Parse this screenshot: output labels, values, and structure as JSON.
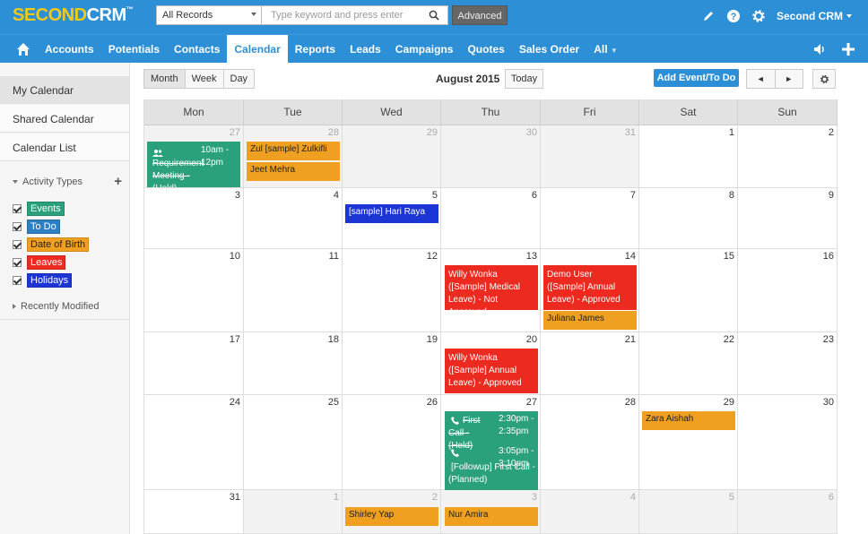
{
  "app": {
    "logo_part1": "SECOND",
    "logo_part2": "CRM",
    "logo_tm": "™",
    "brand_yellow": "#f5c81c",
    "brand_blue": "#2d8fd6"
  },
  "search": {
    "record_type": "All Records",
    "placeholder": "Type keyword and press enter",
    "advanced_label": "Advanced"
  },
  "user": {
    "name": "Second CRM"
  },
  "top_icons": [
    "pencil-icon",
    "help-icon",
    "gear-icon"
  ],
  "nav": {
    "items": [
      "Accounts",
      "Potentials",
      "Contacts",
      "Calendar",
      "Reports",
      "Leads",
      "Campaigns",
      "Quotes",
      "Sales Order",
      "All"
    ],
    "active": "Calendar"
  },
  "sidebar": {
    "items": [
      "My Calendar",
      "Shared Calendar",
      "Calendar List"
    ],
    "activity_types_label": "Activity Types",
    "activity_types": [
      {
        "label": "Events",
        "color": "#2aa07c"
      },
      {
        "label": "To Do",
        "color": "#2d7fc1"
      },
      {
        "label": "Date of Birth",
        "color": "#f0a020"
      },
      {
        "label": "Leaves",
        "color": "#ec2a1f"
      },
      {
        "label": "Holidays",
        "color": "#1c35d5"
      }
    ],
    "recently_modified_label": "Recently Modified"
  },
  "calendar": {
    "views": [
      "Month",
      "Week",
      "Day"
    ],
    "active_view": "Month",
    "title": "August 2015",
    "today_label": "Today",
    "add_label": "Add Event/To Do",
    "prev_label": "◄",
    "next_label": "►",
    "days_of_week": [
      "Mon",
      "Tue",
      "Wed",
      "Thu",
      "Fri",
      "Sat",
      "Sun"
    ],
    "weeks": [
      [
        "27",
        "28",
        "29",
        "30",
        "31",
        "1",
        "2"
      ],
      [
        "3",
        "4",
        "5",
        "6",
        "7",
        "8",
        "9"
      ],
      [
        "10",
        "11",
        "12",
        "13",
        "14",
        "15",
        "16"
      ],
      [
        "17",
        "18",
        "19",
        "20",
        "21",
        "22",
        "23"
      ],
      [
        "24",
        "25",
        "26",
        "27",
        "28",
        "29",
        "30"
      ],
      [
        "31",
        "1",
        "2",
        "3",
        "4",
        "5",
        "6"
      ]
    ],
    "events": {
      "e1_time": "10am - 12pm",
      "e1_title": "Requirement Meeting - (Held)",
      "e2": "Zul [sample] Zulkifli",
      "e3": "Jeet Mehra",
      "e4": "[sample] Hari Raya",
      "e5": "Willy Wonka ([Sample] Medical Leave) - Not Approved",
      "e6": "Demo User ([Sample] Annual Leave) - Approved",
      "e7": "Juliana James",
      "e8": "Willy Wonka ([Sample] Annual Leave) - Approved",
      "e9_title": "First Call - (Held)",
      "e9_time": "2:30pm - 2:35pm",
      "e10_title": "[Followup] First Call - (Planned)",
      "e10_time": "3:05pm - 3:10pm",
      "e11": "Zara Aishah",
      "e12": "Shirley Yap",
      "e13": "Nur Amira"
    }
  }
}
